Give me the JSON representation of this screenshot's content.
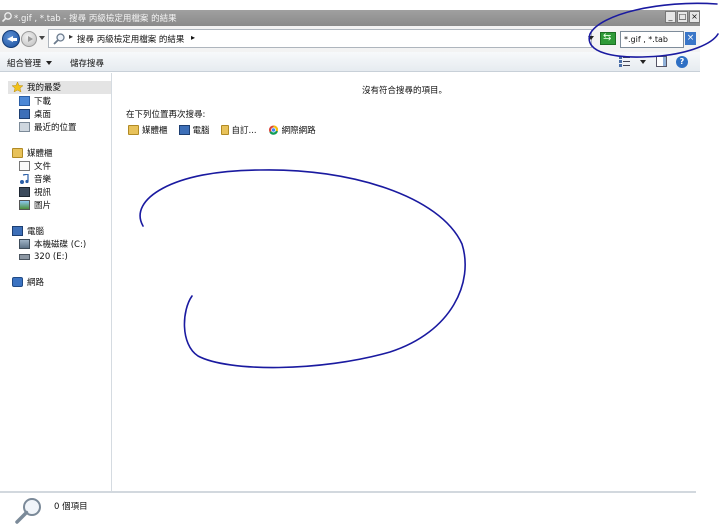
{
  "window": {
    "title": "*.gif , *.tab - 搜尋 丙級檢定用檔案 的結果",
    "controls": {
      "minimize": "_",
      "maximize": "□",
      "close": "×"
    }
  },
  "address": {
    "separator": "▸",
    "path": "搜尋 丙級檢定用檔案 的結果",
    "path_arrow": "▸"
  },
  "search": {
    "value": "*.gif , *.tab"
  },
  "toolbar": {
    "organize": "組合管理",
    "save_search": "儲存搜尋"
  },
  "sidebar": {
    "favorites": {
      "label": "我的最愛",
      "items": [
        {
          "label": "下載",
          "icon": "downloads-folder-icon"
        },
        {
          "label": "桌面",
          "icon": "desktop-icon"
        },
        {
          "label": "最近的位置",
          "icon": "recent-places-icon"
        }
      ]
    },
    "libraries": {
      "label": "媒體櫃",
      "items": [
        {
          "label": "文件",
          "icon": "documents-icon"
        },
        {
          "label": "音樂",
          "icon": "music-icon"
        },
        {
          "label": "視訊",
          "icon": "videos-icon"
        },
        {
          "label": "圖片",
          "icon": "pictures-icon"
        }
      ]
    },
    "computer": {
      "label": "電腦",
      "items": [
        {
          "label": "本機磁碟 (C:)",
          "icon": "local-disk-icon"
        },
        {
          "label": "320 (E:)",
          "icon": "drive-icon"
        }
      ]
    },
    "network": {
      "label": "網路"
    }
  },
  "main": {
    "empty_message": "沒有符合搜尋的項目。",
    "search_again_label": "在下列位置再次搜尋:",
    "search_again_items": [
      {
        "label": "媒體櫃",
        "icon": "libraries-icon"
      },
      {
        "label": "電腦",
        "icon": "computer-icon"
      },
      {
        "label": "自訂...",
        "icon": "custom-icon"
      },
      {
        "label": "網際網路",
        "icon": "internet-icon"
      }
    ]
  },
  "status": {
    "count": "0 個項目"
  },
  "colors": {
    "titlebar": "#8a8a8a",
    "annotation_ink": "#1a1aa0",
    "selection": "#e4e4e4"
  }
}
